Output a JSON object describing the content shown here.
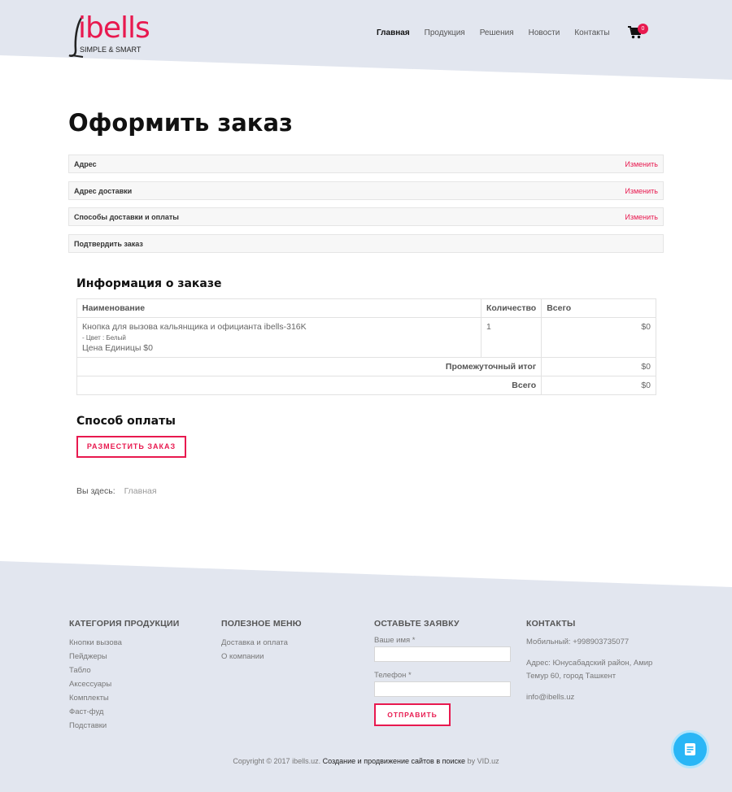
{
  "colors": {
    "accent": "#e8194f",
    "header_bg": "#e2e6ef",
    "footer_bg": "#e2e6ef",
    "chat": "#29b6f6"
  },
  "logo": {
    "word": "ibells",
    "tagline": "SIMPLE & SMART"
  },
  "nav": {
    "items": [
      "Главная",
      "Продукция",
      "Решения",
      "Новости",
      "Контакты"
    ],
    "cart_count": "0"
  },
  "page": {
    "title": "Оформить заказ"
  },
  "steps": [
    {
      "label": "Адрес",
      "edit": "Изменить"
    },
    {
      "label": "Адрес доставки",
      "edit": "Изменить"
    },
    {
      "label": "Способы доставки и оплаты",
      "edit": "Изменить"
    },
    {
      "label": "Подтвердить заказ",
      "edit": ""
    }
  ],
  "order": {
    "heading": "Информация о заказе",
    "headers": {
      "name": "Наименование",
      "qty": "Количество",
      "total": "Всего"
    },
    "item": {
      "name": "Кнопка для вызова кальянщика и официанта ibells-316K",
      "option": "- Цвет : Белый",
      "unit_price": "Цена Единицы $0",
      "qty": "1",
      "total": "$0"
    },
    "subtotal": {
      "label": "Промежуточный итог",
      "value": "$0"
    },
    "grand_total": {
      "label": "Всего",
      "value": "$0"
    }
  },
  "payment": {
    "heading": "Способ оплаты",
    "button": "РАЗМЕСТИТЬ ЗАКАЗ"
  },
  "breadcrumb": {
    "prefix": "Вы здесь:",
    "home": "Главная"
  },
  "footer": {
    "categories": {
      "title": "КАТЕГОРИЯ ПРОДУКЦИИ",
      "items": [
        "Кнопки вызова",
        "Пейджеры",
        "Табло",
        "Аксессуары",
        "Комплекты",
        "Фаст-фуд",
        "Подставки"
      ]
    },
    "menu": {
      "title": "ПОЛЕЗНОЕ МЕНЮ",
      "items": [
        "Доставка и оплата",
        "О компании"
      ]
    },
    "form": {
      "title": "ОСТАВЬТЕ ЗАЯВКУ",
      "name_label": "Ваше имя *",
      "phone_label": "Телефон *",
      "submit": "ОТПРАВИТЬ"
    },
    "contacts": {
      "title": "КОНТАКТЫ",
      "mobile": "Мобильный: +998903735077",
      "address": "Адрес: Юнусабадский район, Амир Темур 60, город Ташкент",
      "email": "info@ibells.uz"
    },
    "copyright_text": "Copyright © 2017 ibells.uz. ",
    "copyright_link": "Создание и продвижение сайтов в поиске",
    "copyright_by": " by VID.uz"
  }
}
